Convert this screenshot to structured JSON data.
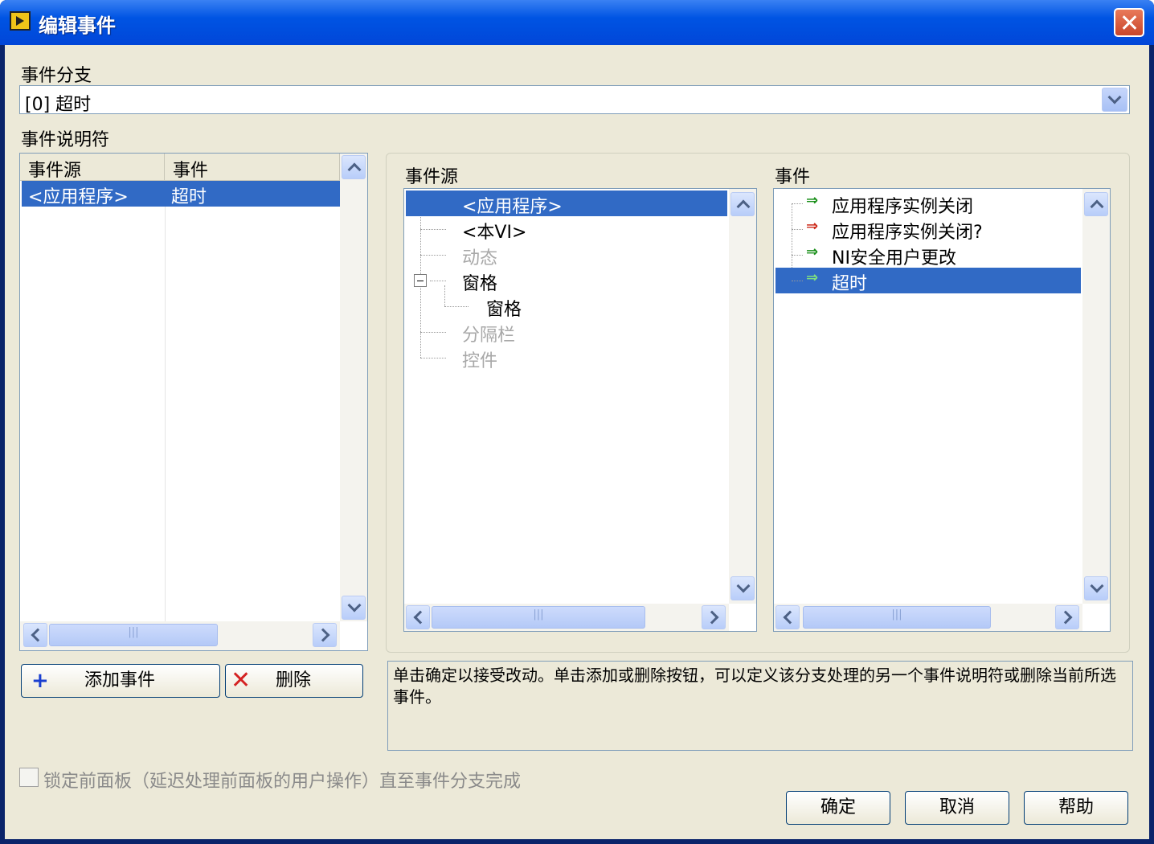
{
  "window": {
    "title": "编辑事件"
  },
  "branch": {
    "label": "事件分支",
    "value": "[0] 超时"
  },
  "specifiers": {
    "label": "事件说明符",
    "headers": [
      "事件源",
      "事件"
    ],
    "rows": [
      {
        "source": "<应用程序>",
        "event": "超时"
      }
    ]
  },
  "sources": {
    "label": "事件源",
    "items": [
      {
        "label": "<应用程序>",
        "state": "selected"
      },
      {
        "label": "<本VI>",
        "state": "normal"
      },
      {
        "label": "动态",
        "state": "disabled"
      },
      {
        "label": "窗格",
        "state": "expanded"
      },
      {
        "label": "窗格",
        "state": "child"
      },
      {
        "label": "分隔栏",
        "state": "disabled"
      },
      {
        "label": "控件",
        "state": "disabled"
      }
    ]
  },
  "events": {
    "label": "事件",
    "items": [
      {
        "label": "应用程序实例关闭",
        "arrow": "green"
      },
      {
        "label": "应用程序实例关闭?",
        "arrow": "red"
      },
      {
        "label": "NI安全用户更改",
        "arrow": "green"
      },
      {
        "label": "超时",
        "arrow": "green",
        "selected": true
      }
    ]
  },
  "buttons": {
    "add": "添加事件",
    "delete": "删除",
    "ok": "确定",
    "cancel": "取消",
    "help": "帮助"
  },
  "description": "单击确定以接受改动。单击添加或删除按钮，可以定义该分支处理的另一个事件说明符或删除当前所选事件。",
  "lock_panel": {
    "label": "锁定前面板（延迟处理前面板的用户操作）直至事件分支完成",
    "checked": false
  },
  "colors": {
    "title_bar": "#0054e3",
    "selection": "#316ac5",
    "green_arrow": "#1a8f1a",
    "red_arrow": "#cc2a1a",
    "dialog_bg": "#ece9d8"
  }
}
